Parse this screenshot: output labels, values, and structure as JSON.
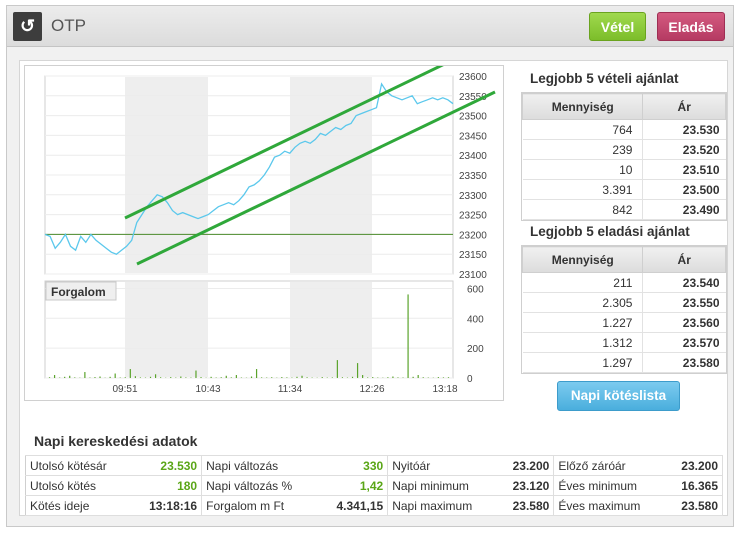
{
  "header": {
    "title": "OTP",
    "buy_label": "Vétel",
    "sell_label": "Eladás"
  },
  "chart_data": [
    {
      "type": "line",
      "x_ticks": [
        "09:51",
        "10:43",
        "11:34",
        "12:26",
        "13:18"
      ],
      "y_ticks": [
        23600,
        23550,
        23500,
        23450,
        23400,
        23350,
        23300,
        23250,
        23200,
        23150,
        23100
      ],
      "ylim": [
        23100,
        23600
      ],
      "reference_line": 23200,
      "series": [
        {
          "values": [
            23200,
            23195,
            23165,
            23180,
            23200,
            23170,
            23160,
            23195,
            23180,
            23200,
            23185,
            23175,
            23165,
            23155,
            23150,
            23160,
            23170,
            23185,
            23230,
            23250,
            23270,
            23285,
            23300,
            23295,
            23280,
            23260,
            23250,
            23255,
            23250,
            23245,
            23240,
            23245,
            23250,
            23260,
            23270,
            23275,
            23280,
            23275,
            23285,
            23300,
            23320,
            23325,
            23335,
            23350,
            23370,
            23395,
            23400,
            23410,
            23405,
            23420,
            23430,
            23435,
            23430,
            23440,
            23455,
            23450,
            23460,
            23470,
            23465,
            23475,
            23480,
            23500,
            23505,
            23510,
            23515,
            23520,
            23580,
            23560,
            23550,
            23545,
            23540,
            23545,
            23550,
            23530,
            23535,
            23540,
            23545,
            23540,
            23545,
            23540,
            23530
          ]
        }
      ]
    },
    {
      "type": "bar",
      "label": "Forgalom",
      "y_ticks": [
        600,
        400,
        200,
        0
      ],
      "ylim": [
        0,
        650
      ],
      "values": [
        5,
        20,
        3,
        8,
        15,
        4,
        2,
        40,
        3,
        6,
        10,
        2,
        8,
        30,
        3,
        5,
        60,
        12,
        4,
        3,
        8,
        25,
        5,
        2,
        6,
        3,
        10,
        4,
        3,
        50,
        6,
        2,
        8,
        3,
        5,
        15,
        4,
        20,
        3,
        2,
        10,
        60,
        4,
        3,
        5,
        2,
        6,
        4,
        3,
        8,
        15,
        5,
        3,
        2,
        6,
        3,
        4,
        120,
        5,
        3,
        8,
        100,
        20,
        4,
        6,
        3,
        2,
        5,
        10,
        4,
        3,
        560,
        8,
        20,
        5,
        3,
        2,
        6,
        4,
        5
      ]
    }
  ],
  "buy_orders": {
    "title": "Legjobb 5 vételi ajánlat",
    "columns": [
      "Mennyiség",
      "Ár"
    ],
    "rows": [
      [
        "764",
        "23.530"
      ],
      [
        "239",
        "23.520"
      ],
      [
        "10",
        "23.510"
      ],
      [
        "3.391",
        "23.500"
      ],
      [
        "842",
        "23.490"
      ]
    ]
  },
  "sell_orders": {
    "title": "Legjobb 5 eladási ajánlat",
    "columns": [
      "Mennyiség",
      "Ár"
    ],
    "rows": [
      [
        "211",
        "23.540"
      ],
      [
        "2.305",
        "23.550"
      ],
      [
        "1.227",
        "23.560"
      ],
      [
        "1.312",
        "23.570"
      ],
      [
        "1.297",
        "23.580"
      ]
    ]
  },
  "napi_button": "Napi kötéslista",
  "daily": {
    "title": "Napi kereskedési adatok",
    "rows": [
      [
        [
          "Utolsó kötésár",
          "23.530"
        ],
        [
          "Napi változás",
          "330"
        ],
        [
          "Nyitóár",
          "23.200"
        ],
        [
          "Előző záróár",
          "23.200"
        ]
      ],
      [
        [
          "Utolsó kötés",
          "180"
        ],
        [
          "Napi változás %",
          "1,42"
        ],
        [
          "Napi minimum",
          "23.120"
        ],
        [
          "Éves minimum",
          "16.365"
        ]
      ],
      [
        [
          "Kötés ideje",
          "13:18:16"
        ],
        [
          "Forgalom m Ft",
          "4.341,15"
        ],
        [
          "Napi maximum",
          "23.580"
        ],
        [
          "Éves maximum",
          "23.580"
        ]
      ]
    ]
  },
  "colors": {
    "price_line": "#5bc8ec",
    "trend_line": "#2fa83a",
    "volume": "#5aa32b",
    "accent_green": "#5aa617"
  }
}
